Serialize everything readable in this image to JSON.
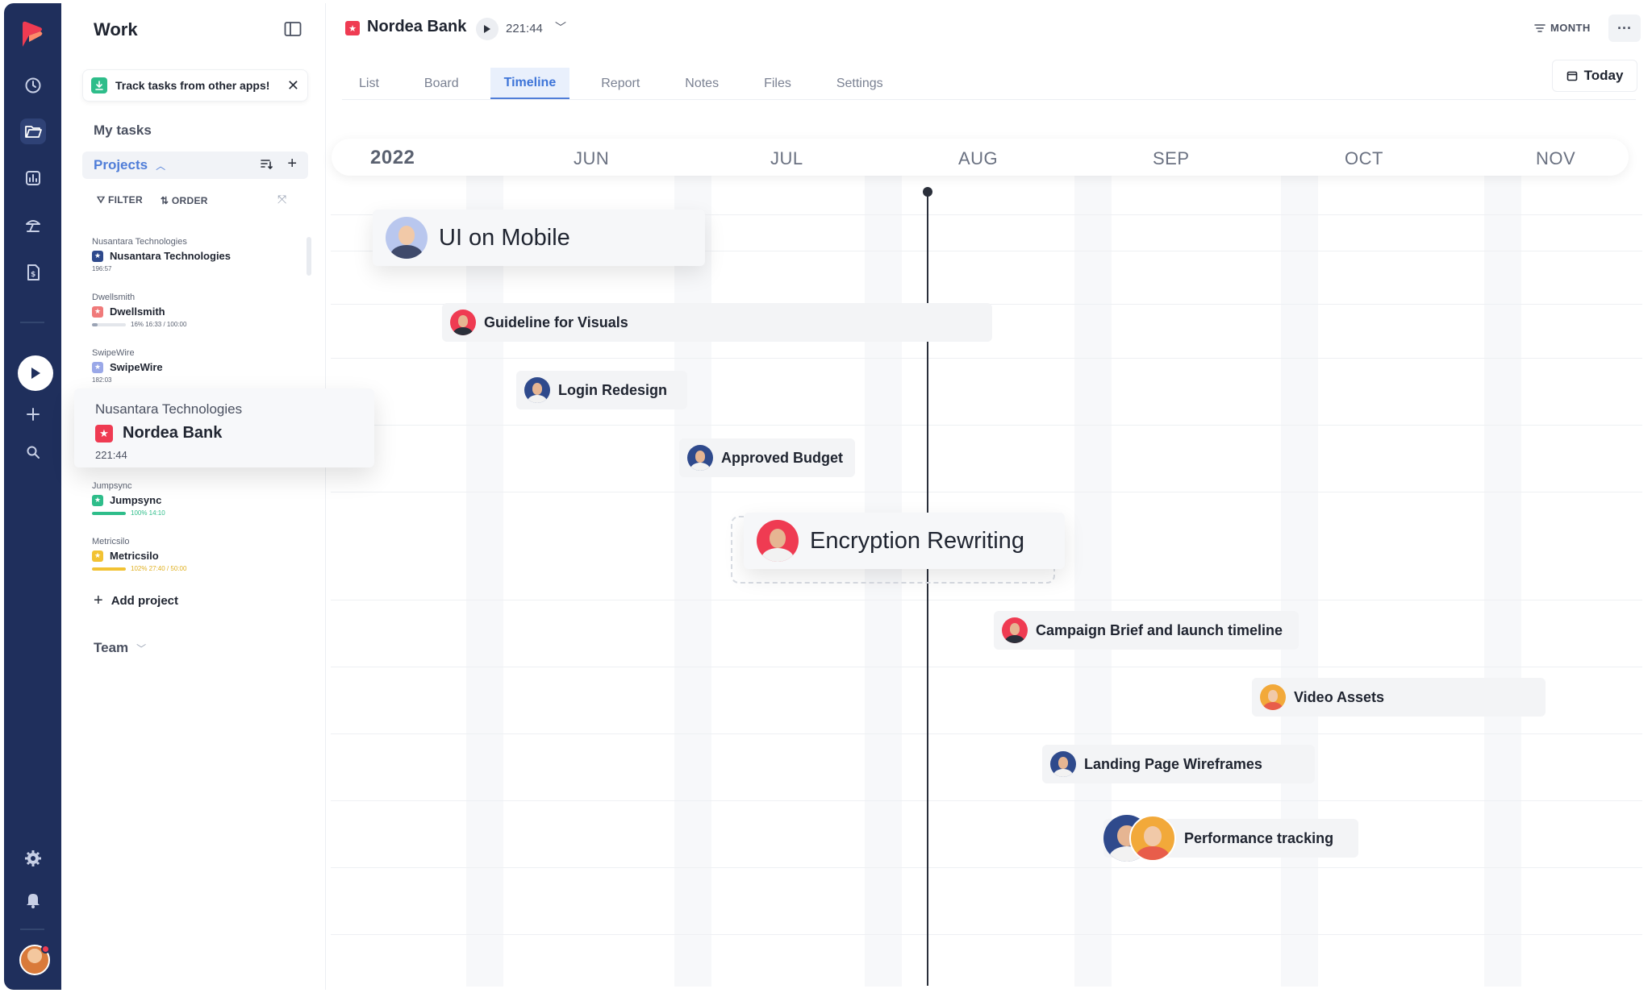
{
  "colors": {
    "rail": "#1f2f5c",
    "accent": "#4f7dd8",
    "brand_red": "#ef3b52",
    "green": "#2ebd8a",
    "yellow": "#f2c233"
  },
  "rail": {
    "icons": [
      "clock-icon",
      "folder-icon",
      "reports-icon",
      "vacation-icon",
      "invoice-icon",
      "play-icon",
      "plus-icon",
      "search-icon",
      "gear-icon",
      "bell-icon"
    ]
  },
  "sidebar": {
    "title": "Work",
    "banner": "Track tasks from other apps!",
    "my_tasks": "My tasks",
    "projects_label": "Projects",
    "filter": "FILTER",
    "order": "ORDER",
    "projects": [
      {
        "client": "Nusantara Technologies",
        "name": "Nusantara Technologies",
        "meta": "196:57",
        "color": "#2f4a8c"
      },
      {
        "client": "Dwellsmith",
        "name": "Dwellsmith",
        "meta": "16% 16:33 / 100:00",
        "color": "#f07a7a",
        "progress": 0.16,
        "bar_color": "#9aa3b4"
      },
      {
        "client": "SwipeWire",
        "name": "SwipeWire",
        "meta": "182:03",
        "color": "#9aa8e8"
      },
      {
        "client": "Nusantara Technologies",
        "name": "Nordea Bank",
        "meta": "221:44",
        "color": "#ef3b52"
      },
      {
        "client": "Jumpsync",
        "name": "Jumpsync",
        "meta": "100% 14:10",
        "color": "#2ebd8a",
        "progress": 1.0,
        "bar_color": "#2ebd8a"
      },
      {
        "client": "Metricsilo",
        "name": "Metricsilo",
        "meta": "102% 27:40 / 50:00",
        "color": "#f2c233",
        "progress": 1.0,
        "bar_color": "#f2c233"
      }
    ],
    "add_project": "Add project",
    "team": "Team"
  },
  "header": {
    "project": "Nordea Bank",
    "time": "221:44",
    "view_mode": "MONTH",
    "tabs": [
      "List",
      "Board",
      "Timeline",
      "Report",
      "Notes",
      "Files",
      "Settings"
    ],
    "active_tab": "Timeline",
    "today": "Today"
  },
  "timeline": {
    "year": "2022",
    "months": [
      "JUN",
      "JUL",
      "AUG",
      "SEP",
      "OCT",
      "NOV"
    ],
    "tasks": [
      {
        "name": "UI on Mobile",
        "avatar": "woman-avatar"
      },
      {
        "name": "Guideline for Visuals",
        "avatar": "man-avatar"
      },
      {
        "name": "Login Redesign",
        "avatar": "man-avatar"
      },
      {
        "name": "Approved Budget",
        "avatar": "man-avatar"
      },
      {
        "name": "Encryption Rewriting",
        "avatar": "man-avatar"
      },
      {
        "name": "Campaign Brief and launch timeline",
        "avatar": "man-avatar"
      },
      {
        "name": "Video Assets",
        "avatar": "woman-avatar"
      },
      {
        "name": "Landing Page Wireframes",
        "avatar": "man-avatar"
      },
      {
        "name": "Performance tracking",
        "avatar": "group-avatar"
      }
    ]
  }
}
